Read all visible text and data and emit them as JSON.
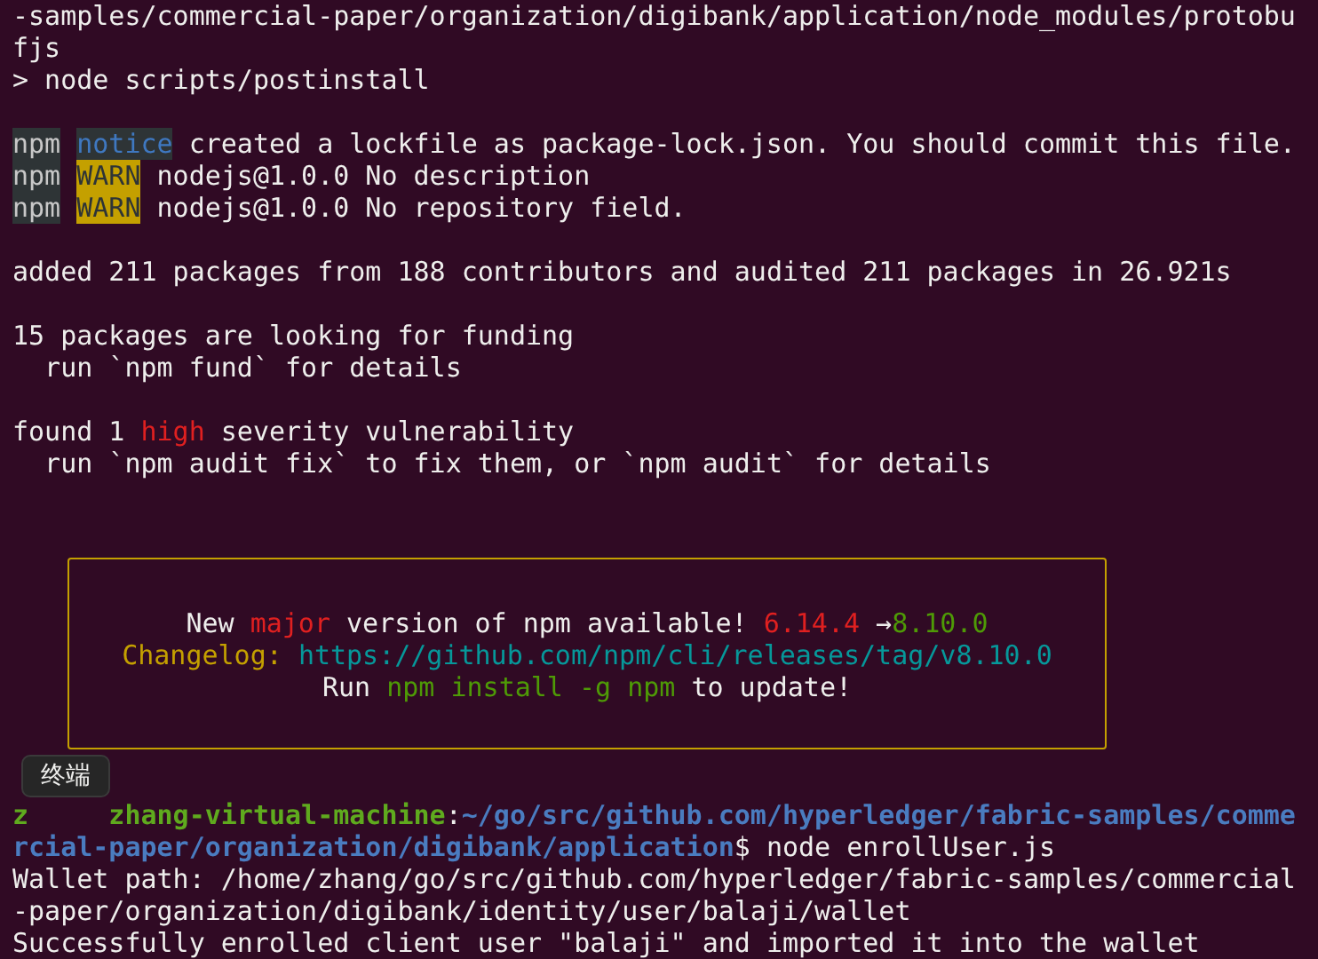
{
  "blocks_before": [
    [
      [
        {
          "kind": "plain",
          "text": "-samples/commercial-paper/organization/digibank/application/node_modules/protobu"
        }
      ],
      [
        {
          "kind": "plain",
          "text": "fjs"
        }
      ],
      [
        {
          "kind": "plain",
          "text": "> node scripts/postinstall"
        }
      ]
    ],
    [
      [
        {
          "kind": "tag",
          "text": "npm"
        },
        {
          "kind": "notice",
          "text": "notice"
        },
        {
          "kind": "plain",
          "text": " created a lockfile as package-lock.json. You should commit this file."
        }
      ],
      [
        {
          "kind": "tag",
          "text": "npm"
        },
        {
          "kind": "warn",
          "text": "WARN"
        },
        {
          "kind": "plain",
          "text": " nodejs@1.0.0 No description"
        }
      ],
      [
        {
          "kind": "tag",
          "text": "npm"
        },
        {
          "kind": "warn",
          "text": "WARN"
        },
        {
          "kind": "plain",
          "text": " nodejs@1.0.0 No repository field."
        }
      ]
    ],
    [
      [
        {
          "kind": "plain",
          "text": "added 211 packages from 188 contributors and audited 211 packages in 26.921s"
        }
      ]
    ],
    [
      [
        {
          "kind": "plain",
          "text": "15 packages are looking for funding"
        }
      ],
      [
        {
          "kind": "plain",
          "text": "  run `npm fund` for details"
        }
      ]
    ],
    [
      [
        {
          "kind": "plain",
          "text": "found 1 "
        },
        {
          "kind": "red",
          "text": "high"
        },
        {
          "kind": "plain",
          "text": " severity vulnerability"
        }
      ],
      [
        {
          "kind": "plain",
          "text": "  run `npm audit fix` to fix them, or `npm audit` for details"
        }
      ]
    ]
  ],
  "update_box": [
    [
      {
        "kind": "plain",
        "text": "New "
      },
      {
        "kind": "red",
        "text": "major"
      },
      {
        "kind": "plain",
        "text": " version of npm available! "
      },
      {
        "kind": "red",
        "text": "6.14.4"
      },
      {
        "kind": "plain",
        "text": " →"
      },
      {
        "kind": "green",
        "text": "8.10.0"
      }
    ],
    [
      {
        "kind": "yellow",
        "text": "Changelog: "
      },
      {
        "kind": "cyan",
        "text": "https://github.com/npm/cli/releases/tag/v8.10.0"
      }
    ],
    [
      {
        "kind": "plain",
        "text": "Run "
      },
      {
        "kind": "green",
        "text": "npm install -g npm"
      },
      {
        "kind": "plain",
        "text": " to update!"
      }
    ]
  ],
  "lines_after": [
    [
      {
        "kind": "host",
        "text": "z"
      },
      {
        "kind": "gap"
      },
      {
        "kind": "host",
        "text": "zhang-virtual-machine"
      },
      {
        "kind": "plain",
        "text": ":"
      },
      {
        "kind": "path",
        "text": "~/go/src/github.com/hyperledger/fabric-samples/comme"
      }
    ],
    [
      {
        "kind": "path",
        "text": "rcial-paper/organization/digibank/application"
      },
      {
        "kind": "plain",
        "text": "$ node enrollUser.js"
      }
    ],
    [
      {
        "kind": "plain",
        "text": "Wallet path: /home/zhang/go/src/github.com/hyperledger/fabric-samples/commercial"
      }
    ],
    [
      {
        "kind": "plain",
        "text": "-paper/organization/digibank/identity/user/balaji/wallet"
      }
    ],
    [
      {
        "kind": "plain",
        "text": "Successfully enrolled client user \"balaji\" and imported it into the wallet"
      }
    ]
  ],
  "tooltip": "终端"
}
